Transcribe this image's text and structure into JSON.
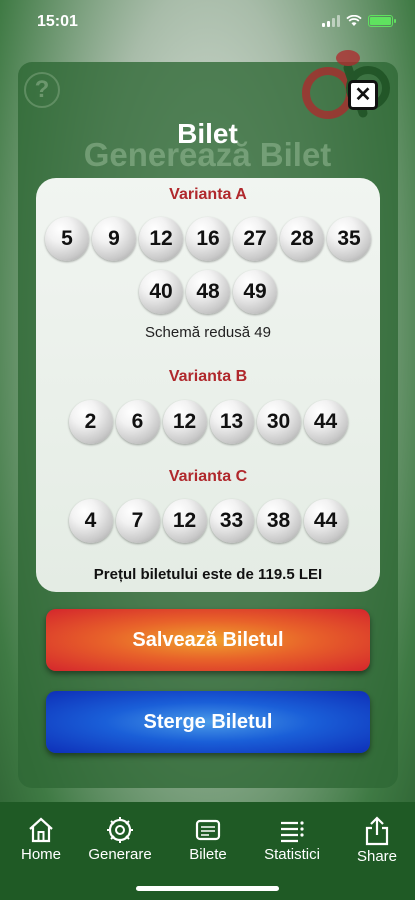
{
  "status_bar": {
    "time": "15:01"
  },
  "background": {
    "title": "Generează Bilet"
  },
  "modal": {
    "title": "Bilet",
    "variants": [
      {
        "label": "Varianta A",
        "numbers": [
          [
            "5",
            "9",
            "12",
            "16",
            "27",
            "28",
            "35"
          ],
          [
            "40",
            "48",
            "49"
          ]
        ],
        "scheme": "Schemă redusă 49"
      },
      {
        "label": "Varianta B",
        "numbers": [
          [
            "2",
            "6",
            "12",
            "13",
            "30",
            "44"
          ]
        ]
      },
      {
        "label": "Varianta C",
        "numbers": [
          [
            "4",
            "7",
            "12",
            "33",
            "38",
            "44"
          ]
        ]
      }
    ],
    "price": "Prețul biletului este de 119.5 LEI",
    "save_label": "Salvează Biletul",
    "delete_label": "Sterge Biletul"
  },
  "tabbar": {
    "items": [
      {
        "label": "Home",
        "icon": "home-icon"
      },
      {
        "label": "Generare",
        "icon": "gear-icon"
      },
      {
        "label": "Bilete",
        "icon": "ticket-icon"
      },
      {
        "label": "Statistici",
        "icon": "list-icon"
      },
      {
        "label": "Share",
        "icon": "share-icon"
      }
    ]
  },
  "colors": {
    "variant_title": "#b0282c",
    "tabbar": "#1f5a25",
    "save_button": "#d4262c",
    "delete_button": "#0e2fb8"
  }
}
